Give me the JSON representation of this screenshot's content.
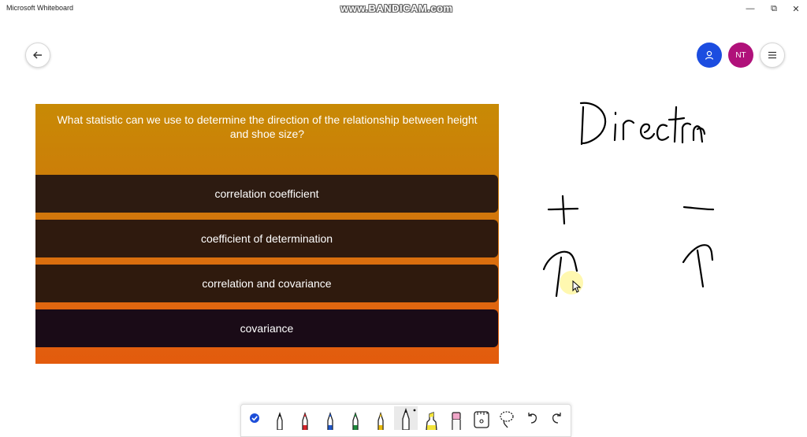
{
  "window": {
    "title": "Microsoft Whiteboard",
    "watermark": "www.BANDICAM.com",
    "minimize_glyph": "—",
    "maximize_glyph": "⧉",
    "close_glyph": "✕"
  },
  "canvas_controls": {
    "back_icon": "arrow-left-icon",
    "share_icon": "person-icon",
    "avatar_initials": "NT",
    "menu_icon": "hamburger-icon"
  },
  "quiz": {
    "question": "What statistic can we use to determine the direction of the relationship between height and shoe size?",
    "answers": [
      "correlation coefficient",
      "coefficient of determination",
      "correlation and covariance",
      "covariance"
    ]
  },
  "handwriting": {
    "word": "Direction",
    "positive_symbol": "+",
    "negative_symbol": "−"
  },
  "toolbar": {
    "tools": [
      "select-check-icon",
      "black-pen-icon",
      "red-pen-icon",
      "blue-pen-icon",
      "green-pen-icon",
      "yellow-pen-icon",
      "pencil-icon",
      "highlighter-icon",
      "eraser-icon",
      "ruler-icon",
      "lasso-icon",
      "undo-icon",
      "redo-icon"
    ]
  },
  "colors": {
    "share_button": "#1c4de0",
    "avatar": "#b0117a",
    "quiz_top": "#c88a05",
    "quiz_bottom": "#e35b0d"
  }
}
